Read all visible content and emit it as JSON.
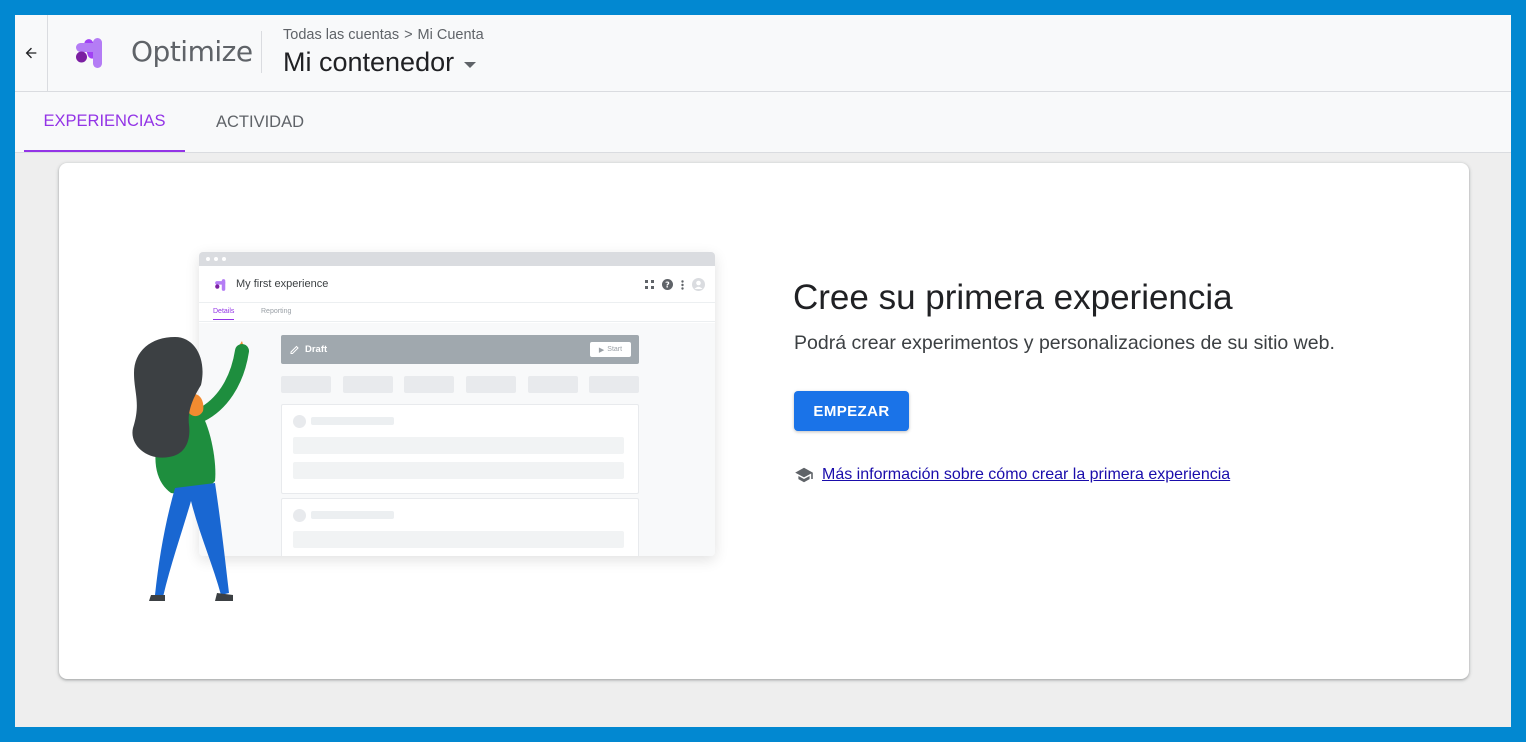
{
  "header": {
    "back_icon": "arrow-back-icon",
    "brand_name": "Optimize",
    "breadcrumb": {
      "account_all": "Todas las cuentas",
      "separator": ">",
      "account": "Mi Cuenta"
    },
    "container_name": "Mi contenedor"
  },
  "tabs": [
    {
      "label": "EXPERIENCIAS",
      "active": true
    },
    {
      "label": "ACTIVIDAD",
      "active": false
    }
  ],
  "illustration": {
    "title": "My first experience",
    "tabs": [
      "Details",
      "Reporting"
    ],
    "status": "Draft",
    "start_label": "Start"
  },
  "main": {
    "headline": "Cree su primera experiencia",
    "subtext": "Podrá crear experimentos y personalizaciones de su sitio web.",
    "cta_label": "EMPEZAR",
    "learn_more": " Más información sobre cómo crear la primera experiencia",
    "learn_icon": "school-icon"
  },
  "colors": {
    "accent": "#9334e6",
    "primary": "#1a73e8",
    "outer_frame": "#0288d1",
    "link": "#1a0dab"
  }
}
